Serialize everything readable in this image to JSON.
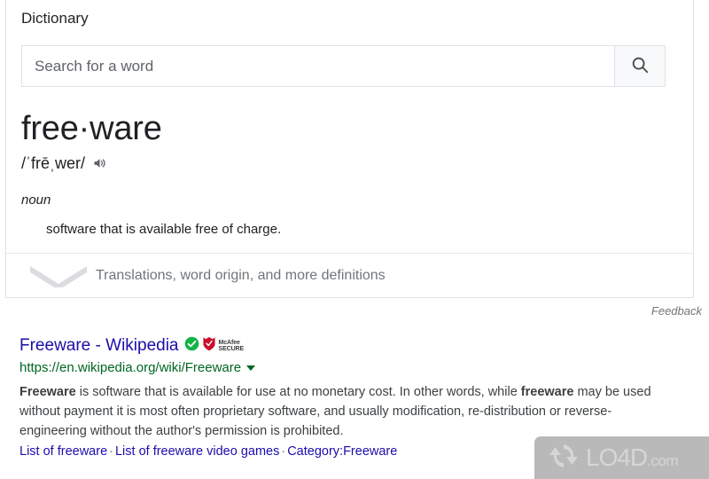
{
  "dictionary_card": {
    "heading": "Dictionary",
    "search": {
      "placeholder": "Search for a word",
      "value": "",
      "button_icon": "search-icon"
    },
    "word": "free·ware",
    "phonetic": "/ˈfrēˌwer/",
    "speaker_icon": "speaker-icon",
    "part_of_speech": "noun",
    "definition": "software that is available free of charge.",
    "expander": {
      "icon": "chevron-down-icon",
      "label": "Translations, word origin, and more definitions"
    }
  },
  "feedback": {
    "label": "Feedback"
  },
  "result": {
    "title": "Freeware - Wikipedia",
    "badges": {
      "verified_icon": "green-check-circle-icon",
      "shield_icon": "red-shield-icon",
      "mcafee_line1": "McAfee",
      "mcafee_line2": "SECURE"
    },
    "url": "https://en.wikipedia.org/wiki/Freeware",
    "url_caret_icon": "caret-down-icon",
    "snippet": {
      "part1_bold": "Freeware",
      "part2": " is software that is available for use at no monetary cost. In other words, while ",
      "part3_bold": "freeware",
      "part4": " may be used without payment it is most often proprietary software, and usually modification, re-distribution or reverse-engineering without the author's permission is prohibited."
    },
    "sitelinks": [
      "List of freeware",
      "List of freeware video games",
      "Category:Freeware"
    ],
    "sitelink_separator": "·"
  },
  "watermark": {
    "icon": "refresh-circle-icon",
    "name": "LO4D",
    "tld": ".com"
  },
  "colors": {
    "link_blue": "#1a0dab",
    "url_green": "#006621",
    "muted_gray": "#70757a",
    "border_gray": "#dfe1e5",
    "badge_green": "#1db954",
    "badge_red": "#c8102e",
    "watermark_bg": "#b9b9b9"
  }
}
